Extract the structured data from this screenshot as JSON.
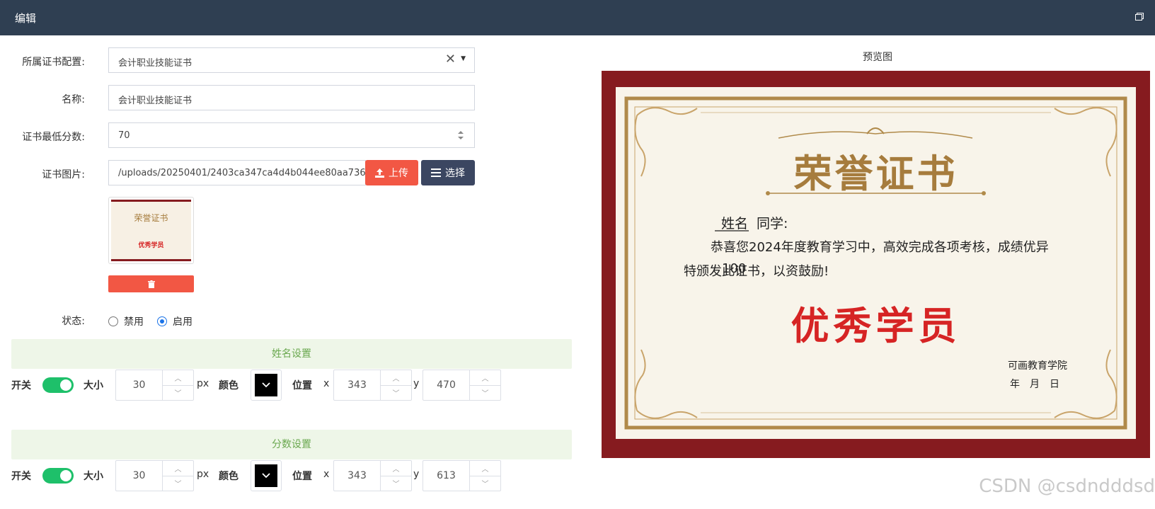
{
  "window": {
    "title": "编辑"
  },
  "form": {
    "config_label": "所属证书配置:",
    "config_value": "会计职业技能证书",
    "name_label": "名称:",
    "name_value": "会计职业技能证书",
    "min_score_label": "证书最低分数:",
    "min_score_value": "70",
    "image_label": "证书图片:",
    "image_path": "/uploads/20250401/2403ca347ca4d4b044ee80aa736",
    "upload_label": "上传",
    "choose_label": "选择",
    "status_label": "状态:",
    "status_options": [
      "禁用",
      "启用"
    ],
    "status_selected": "启用"
  },
  "name_settings": {
    "title": "姓名设置",
    "switch_label": "开关",
    "switch_on": true,
    "size_label": "大小",
    "size_value": "30",
    "size_unit": "px",
    "color_label": "颜色",
    "color": "#000000",
    "position_label": "位置",
    "x_label": "x",
    "x_value": "343",
    "y_label": "y",
    "y_value": "470"
  },
  "score_settings": {
    "title": "分数设置",
    "switch_label": "开关",
    "switch_on": true,
    "size_label": "大小",
    "size_value": "30",
    "size_unit": "px",
    "color_label": "颜色",
    "color": "#000000",
    "position_label": "位置",
    "x_label": "x",
    "x_value": "343",
    "y_label": "y",
    "y_value": "613"
  },
  "preview": {
    "title": "预览图",
    "heading": "荣誉证书",
    "name_placeholder": "姓名",
    "salutation": "同学:",
    "body_line1": "恭喜您2024年度教育学习中，高效完成各项考核，成绩优异",
    "body_line2": "特颁发此证书，以资鼓励!",
    "score_overlay": "100",
    "award": "优秀学员",
    "issuer": "可画教育学院",
    "date": "年　月　日"
  },
  "thumbnail": {
    "heading": "荣誉证书",
    "award": "优秀学员"
  },
  "watermark": "CSDN @csdndddsd",
  "colors": {
    "header_bg": "#2f3f52",
    "accent_red": "#f25744",
    "dark_btn": "#3b4661",
    "toggle_on": "#1ec06a",
    "cert_frame": "#861b1f",
    "gold": "#a67c3d",
    "award_red": "#d62424"
  }
}
